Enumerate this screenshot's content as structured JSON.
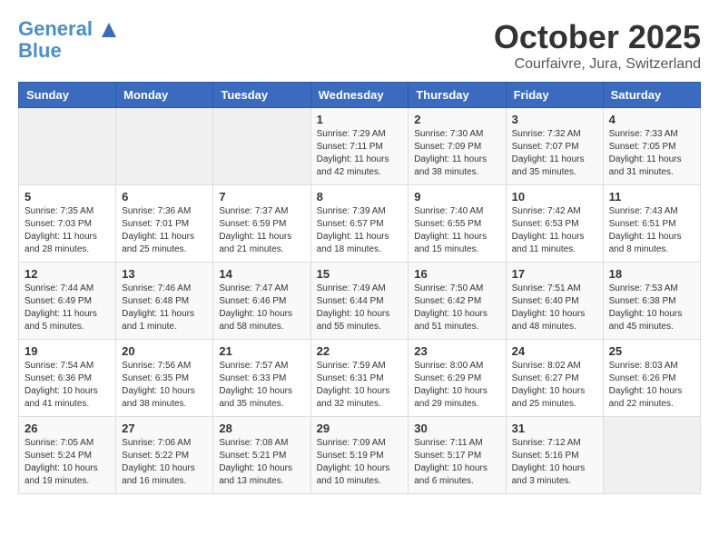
{
  "header": {
    "logo_line1": "General",
    "logo_line2": "Blue",
    "month": "October 2025",
    "location": "Courfaivre, Jura, Switzerland"
  },
  "columns": [
    "Sunday",
    "Monday",
    "Tuesday",
    "Wednesday",
    "Thursday",
    "Friday",
    "Saturday"
  ],
  "weeks": [
    [
      {
        "day": "",
        "info": ""
      },
      {
        "day": "",
        "info": ""
      },
      {
        "day": "",
        "info": ""
      },
      {
        "day": "1",
        "info": "Sunrise: 7:29 AM\nSunset: 7:11 PM\nDaylight: 11 hours and 42 minutes."
      },
      {
        "day": "2",
        "info": "Sunrise: 7:30 AM\nSunset: 7:09 PM\nDaylight: 11 hours and 38 minutes."
      },
      {
        "day": "3",
        "info": "Sunrise: 7:32 AM\nSunset: 7:07 PM\nDaylight: 11 hours and 35 minutes."
      },
      {
        "day": "4",
        "info": "Sunrise: 7:33 AM\nSunset: 7:05 PM\nDaylight: 11 hours and 31 minutes."
      }
    ],
    [
      {
        "day": "5",
        "info": "Sunrise: 7:35 AM\nSunset: 7:03 PM\nDaylight: 11 hours and 28 minutes."
      },
      {
        "day": "6",
        "info": "Sunrise: 7:36 AM\nSunset: 7:01 PM\nDaylight: 11 hours and 25 minutes."
      },
      {
        "day": "7",
        "info": "Sunrise: 7:37 AM\nSunset: 6:59 PM\nDaylight: 11 hours and 21 minutes."
      },
      {
        "day": "8",
        "info": "Sunrise: 7:39 AM\nSunset: 6:57 PM\nDaylight: 11 hours and 18 minutes."
      },
      {
        "day": "9",
        "info": "Sunrise: 7:40 AM\nSunset: 6:55 PM\nDaylight: 11 hours and 15 minutes."
      },
      {
        "day": "10",
        "info": "Sunrise: 7:42 AM\nSunset: 6:53 PM\nDaylight: 11 hours and 11 minutes."
      },
      {
        "day": "11",
        "info": "Sunrise: 7:43 AM\nSunset: 6:51 PM\nDaylight: 11 hours and 8 minutes."
      }
    ],
    [
      {
        "day": "12",
        "info": "Sunrise: 7:44 AM\nSunset: 6:49 PM\nDaylight: 11 hours and 5 minutes."
      },
      {
        "day": "13",
        "info": "Sunrise: 7:46 AM\nSunset: 6:48 PM\nDaylight: 11 hours and 1 minute."
      },
      {
        "day": "14",
        "info": "Sunrise: 7:47 AM\nSunset: 6:46 PM\nDaylight: 10 hours and 58 minutes."
      },
      {
        "day": "15",
        "info": "Sunrise: 7:49 AM\nSunset: 6:44 PM\nDaylight: 10 hours and 55 minutes."
      },
      {
        "day": "16",
        "info": "Sunrise: 7:50 AM\nSunset: 6:42 PM\nDaylight: 10 hours and 51 minutes."
      },
      {
        "day": "17",
        "info": "Sunrise: 7:51 AM\nSunset: 6:40 PM\nDaylight: 10 hours and 48 minutes."
      },
      {
        "day": "18",
        "info": "Sunrise: 7:53 AM\nSunset: 6:38 PM\nDaylight: 10 hours and 45 minutes."
      }
    ],
    [
      {
        "day": "19",
        "info": "Sunrise: 7:54 AM\nSunset: 6:36 PM\nDaylight: 10 hours and 41 minutes."
      },
      {
        "day": "20",
        "info": "Sunrise: 7:56 AM\nSunset: 6:35 PM\nDaylight: 10 hours and 38 minutes."
      },
      {
        "day": "21",
        "info": "Sunrise: 7:57 AM\nSunset: 6:33 PM\nDaylight: 10 hours and 35 minutes."
      },
      {
        "day": "22",
        "info": "Sunrise: 7:59 AM\nSunset: 6:31 PM\nDaylight: 10 hours and 32 minutes."
      },
      {
        "day": "23",
        "info": "Sunrise: 8:00 AM\nSunset: 6:29 PM\nDaylight: 10 hours and 29 minutes."
      },
      {
        "day": "24",
        "info": "Sunrise: 8:02 AM\nSunset: 6:27 PM\nDaylight: 10 hours and 25 minutes."
      },
      {
        "day": "25",
        "info": "Sunrise: 8:03 AM\nSunset: 6:26 PM\nDaylight: 10 hours and 22 minutes."
      }
    ],
    [
      {
        "day": "26",
        "info": "Sunrise: 7:05 AM\nSunset: 5:24 PM\nDaylight: 10 hours and 19 minutes."
      },
      {
        "day": "27",
        "info": "Sunrise: 7:06 AM\nSunset: 5:22 PM\nDaylight: 10 hours and 16 minutes."
      },
      {
        "day": "28",
        "info": "Sunrise: 7:08 AM\nSunset: 5:21 PM\nDaylight: 10 hours and 13 minutes."
      },
      {
        "day": "29",
        "info": "Sunrise: 7:09 AM\nSunset: 5:19 PM\nDaylight: 10 hours and 10 minutes."
      },
      {
        "day": "30",
        "info": "Sunrise: 7:11 AM\nSunset: 5:17 PM\nDaylight: 10 hours and 6 minutes."
      },
      {
        "day": "31",
        "info": "Sunrise: 7:12 AM\nSunset: 5:16 PM\nDaylight: 10 hours and 3 minutes."
      },
      {
        "day": "",
        "info": ""
      }
    ]
  ]
}
